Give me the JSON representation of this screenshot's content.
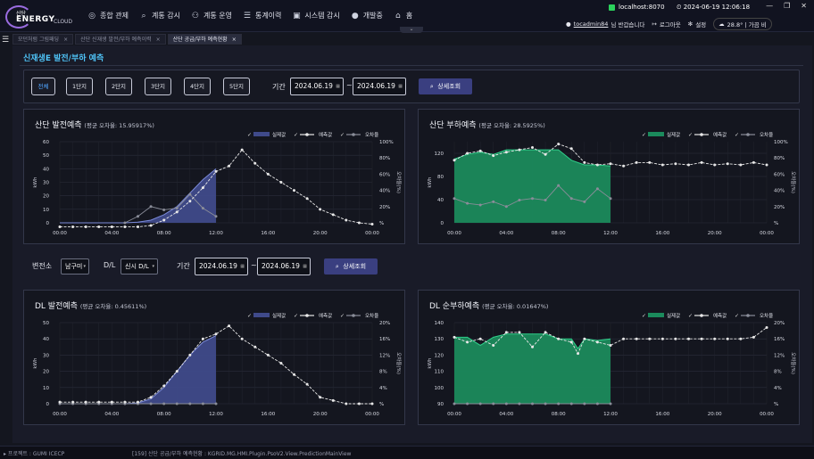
{
  "header": {
    "logo": {
      "line1": "산단",
      "line2": "ENERGY",
      "line3": "CLOUD"
    },
    "nav": [
      {
        "label": "종합 관제",
        "icon": "dashboard-icon",
        "glyph": "◎"
      },
      {
        "label": "계통 감시",
        "icon": "search-icon",
        "glyph": "⌕"
      },
      {
        "label": "계통 운영",
        "icon": "network-icon",
        "glyph": "⚇"
      },
      {
        "label": "통계이력",
        "icon": "list-icon",
        "glyph": "☰"
      },
      {
        "label": "시스템 감시",
        "icon": "monitor-icon",
        "glyph": "▣"
      },
      {
        "label": "개발중",
        "icon": "user-icon",
        "glyph": "●"
      },
      {
        "label": "홈",
        "icon": "home-icon",
        "glyph": "⌂"
      }
    ],
    "server": "localhost:8070",
    "datetime": "2024-06-19 12:06:18",
    "user": "tocadmin84",
    "greeting": "님 반갑습니다",
    "logout": "로그아웃",
    "settings": "설정",
    "weather": "28.8°  |  가끔 비"
  },
  "tabs": [
    {
      "label": "모던처럼 그림패딩",
      "active": false
    },
    {
      "label": "산단 신재생 발전/부하 예측이력",
      "active": false
    },
    {
      "label": "산단 공급/부하 예측현황",
      "active": true
    }
  ],
  "page": {
    "title": "신재생E 발전/부하 예측"
  },
  "filter1": {
    "buttons": [
      "전체",
      "1단지",
      "2단지",
      "3단지",
      "4단지",
      "5단지"
    ],
    "period_label": "기간",
    "from": "2024.06.19",
    "to": "2024.06.19",
    "search": "상세조회"
  },
  "filter2": {
    "substation_label": "변전소",
    "substation": "남구미",
    "dl_label": "D/L",
    "dl": "신시 D/L",
    "period_label": "기간",
    "from": "2024.06.19",
    "to": "2024.06.19",
    "search": "상세조회"
  },
  "legend": {
    "actual": "실제값",
    "forecast": "예측값",
    "error": "오차율"
  },
  "colors": {
    "accent": "#4fc3f7",
    "gen_fill": "#3f4a8a",
    "load_fill": "#1b8a5c",
    "forecast": "#e8e8e8",
    "error": "#8a8d99"
  },
  "statusbar": {
    "left": "▸ 프로젝트 : GUMI ICECP",
    "right": "[159] 산단 공급/부하 예측현황 : KGRID.MG.HMI.Plugin.PsoV2.View.PredictionMainView"
  },
  "chart_data": [
    {
      "id": "sandan-gen",
      "type": "area",
      "title": "산단 발전예측",
      "subtitle": "(평균 오차율: 15.95917%)",
      "ylabel": "kWh",
      "y2label": "오차율(%)",
      "ylim": [
        0,
        60
      ],
      "yticks": [
        0,
        10,
        20,
        30,
        40,
        50,
        60
      ],
      "y2lim": [
        0,
        100
      ],
      "y2ticks": [
        "%",
        "20%",
        "40%",
        "60%",
        "80%",
        "100%"
      ],
      "xticks": [
        "00:00",
        "04:00",
        "08:00",
        "12:00",
        "16:00",
        "20:00",
        "00:00"
      ],
      "x_hours": [
        0,
        1,
        2,
        3,
        4,
        5,
        6,
        7,
        8,
        9,
        10,
        11,
        12,
        13,
        14,
        15,
        16,
        17,
        18,
        19,
        20,
        21,
        22,
        23,
        24
      ],
      "actual": [
        0,
        0,
        0,
        0,
        0,
        0,
        0.5,
        2,
        6,
        12,
        22,
        32,
        40,
        null,
        null,
        null,
        null,
        null,
        null,
        null,
        null,
        null,
        null,
        null,
        null
      ],
      "actual_x": [
        0,
        1,
        2,
        3,
        4,
        5,
        6,
        7,
        8,
        9,
        10,
        11,
        12
      ],
      "forecast_x": [
        0,
        1,
        2,
        3,
        4,
        5,
        6,
        7,
        8,
        9,
        10,
        11,
        12,
        13,
        14,
        15,
        16,
        17,
        18,
        19,
        20,
        21,
        22,
        23,
        24
      ],
      "forecast": [
        -3,
        -3,
        -3,
        -3,
        -3,
        -3,
        -3,
        -2,
        2,
        8,
        16,
        26,
        38,
        42,
        54,
        44,
        36,
        30,
        24,
        18,
        10,
        6,
        2,
        0,
        -1
      ],
      "error_x": [
        5,
        6,
        7,
        8,
        9,
        10,
        11,
        12
      ],
      "error": [
        0,
        8,
        20,
        16,
        18,
        35,
        18,
        8
      ]
    },
    {
      "id": "sandan-load",
      "type": "area",
      "title": "산단 부하예측",
      "subtitle": "(평균 오차율: 28.5925%)",
      "ylabel": "kWh",
      "y2label": "오차율(%)",
      "ylim": [
        0,
        140
      ],
      "yticks": [
        0,
        40,
        80,
        120
      ],
      "y2lim": [
        0,
        100
      ],
      "y2ticks": [
        "%",
        "20%",
        "40%",
        "60%",
        "80%",
        "100%"
      ],
      "xticks": [
        "00:00",
        "04:00",
        "08:00",
        "12:00",
        "16:00",
        "20:00",
        "00:00"
      ],
      "actual_x": [
        0,
        1,
        2,
        3,
        4,
        5,
        6,
        7,
        8,
        9,
        10,
        11,
        12
      ],
      "actual": [
        110,
        118,
        122,
        118,
        126,
        126,
        126,
        126,
        126,
        108,
        100,
        100,
        98
      ],
      "forecast_x": [
        0,
        1,
        2,
        3,
        4,
        5,
        6,
        7,
        8,
        9,
        10,
        11,
        12,
        13,
        14,
        15,
        16,
        17,
        18,
        19,
        20,
        21,
        22,
        23,
        24
      ],
      "forecast": [
        108,
        120,
        124,
        116,
        122,
        126,
        130,
        118,
        136,
        128,
        104,
        100,
        102,
        98,
        104,
        104,
        100,
        102,
        100,
        104,
        100,
        102,
        100,
        104,
        100
      ],
      "error_x": [
        0,
        1,
        2,
        3,
        4,
        5,
        6,
        7,
        8,
        9,
        10,
        11,
        12
      ],
      "error": [
        30,
        24,
        22,
        26,
        20,
        28,
        30,
        28,
        46,
        30,
        26,
        42,
        30
      ]
    },
    {
      "id": "dl-gen",
      "type": "area",
      "title": "DL 발전예측",
      "subtitle": "(평균 오차율: 0.45611%)",
      "ylabel": "kWh",
      "y2label": "오차율(%)",
      "ylim": [
        0,
        50
      ],
      "yticks": [
        0,
        10,
        20,
        30,
        40,
        50
      ],
      "y2lim": [
        0,
        20
      ],
      "y2ticks": [
        "%",
        "4%",
        "8%",
        "12%",
        "16%",
        "20%"
      ],
      "xticks": [
        "00:00",
        "04:00",
        "08:00",
        "12:00",
        "16:00",
        "20:00",
        "00:00"
      ],
      "actual_x": [
        0,
        1,
        2,
        3,
        4,
        5,
        6,
        7,
        8,
        9,
        10,
        11,
        12
      ],
      "actual": [
        0,
        0,
        0,
        0,
        0,
        0,
        0.5,
        3,
        10,
        20,
        30,
        38,
        42
      ],
      "forecast_x": [
        0,
        1,
        2,
        3,
        4,
        5,
        6,
        7,
        8,
        9,
        10,
        11,
        12,
        13,
        14,
        15,
        16,
        17,
        18,
        19,
        20,
        21,
        22,
        23,
        24
      ],
      "forecast": [
        1,
        1,
        1,
        1,
        1,
        1,
        1,
        4,
        11,
        20,
        30,
        40,
        43,
        48,
        40,
        35,
        30,
        25,
        18,
        12,
        4,
        2,
        0,
        0,
        0
      ],
      "error_x": [
        0,
        1,
        2,
        3,
        4,
        5,
        6,
        7,
        8,
        9,
        10,
        11,
        12
      ],
      "error": [
        0,
        0,
        0,
        0,
        0,
        0,
        0,
        0,
        0,
        0,
        0,
        0,
        0
      ]
    },
    {
      "id": "dl-net-load",
      "type": "area",
      "title": "DL 순부하예측",
      "subtitle": "(평균 오차율: 0.01647%)",
      "ylabel": "kWh",
      "y2label": "오차율(%)",
      "ylim": [
        90,
        140
      ],
      "yticks": [
        90,
        100,
        110,
        120,
        130,
        140
      ],
      "y2lim": [
        0,
        20
      ],
      "y2ticks": [
        "%",
        "4%",
        "8%",
        "12%",
        "16%",
        "20%"
      ],
      "xticks": [
        "00:00",
        "04:00",
        "08:00",
        "12:00",
        "16:00",
        "20:00",
        "00:00"
      ],
      "actual_x": [
        0,
        1,
        2,
        3,
        4,
        5,
        6,
        7,
        8,
        9,
        9.5,
        10,
        11,
        12
      ],
      "actual": [
        131,
        131,
        126,
        131,
        133,
        133,
        133,
        133,
        130,
        130,
        124,
        130,
        129,
        130
      ],
      "forecast_x": [
        0,
        1,
        2,
        3,
        4,
        5,
        6,
        7,
        8,
        9,
        9.5,
        10,
        11,
        12,
        13,
        14,
        15,
        16,
        17,
        18,
        19,
        20,
        21,
        22,
        23,
        24
      ],
      "forecast": [
        131,
        128,
        130,
        126,
        134,
        134,
        125,
        134,
        130,
        128,
        121,
        130,
        128,
        126,
        130,
        130,
        130,
        130,
        130,
        130,
        130,
        130,
        130,
        130,
        131,
        137
      ],
      "error_x": [
        0,
        1,
        2,
        3,
        4,
        5,
        6,
        7,
        8,
        9,
        10,
        11,
        12
      ],
      "error": [
        0,
        0,
        0,
        0,
        0,
        0,
        0,
        0,
        0,
        0,
        0,
        0,
        0
      ]
    }
  ]
}
